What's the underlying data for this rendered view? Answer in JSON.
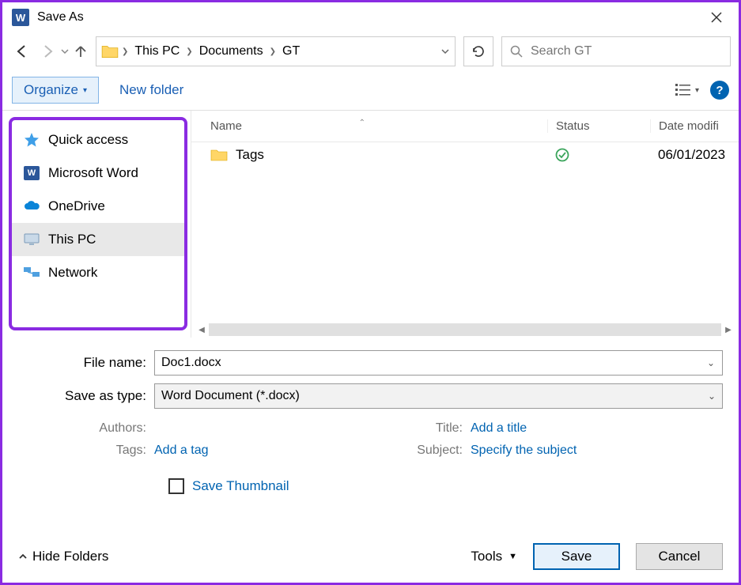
{
  "window": {
    "title": "Save As"
  },
  "breadcrumb": {
    "items": [
      "This PC",
      "Documents",
      "GT"
    ]
  },
  "search": {
    "placeholder": "Search GT"
  },
  "toolbar": {
    "organize": "Organize",
    "new_folder": "New folder"
  },
  "sidebar": {
    "items": [
      {
        "label": "Quick access",
        "icon": "star-icon"
      },
      {
        "label": "Microsoft Word",
        "icon": "word-icon"
      },
      {
        "label": "OneDrive",
        "icon": "cloud-icon"
      },
      {
        "label": "This PC",
        "icon": "pc-icon",
        "selected": true
      },
      {
        "label": "Network",
        "icon": "network-icon"
      }
    ]
  },
  "columns": {
    "name": "Name",
    "status": "Status",
    "date": "Date modifi"
  },
  "files": [
    {
      "name": "Tags",
      "type": "folder",
      "status": "synced",
      "date": "06/01/2023"
    }
  ],
  "form": {
    "file_name_label": "File name:",
    "file_name_value": "Doc1.docx",
    "save_type_label": "Save as type:",
    "save_type_value": "Word Document (*.docx)",
    "authors_label": "Authors:",
    "authors_value": "",
    "tags_label": "Tags:",
    "tags_value": "Add a tag",
    "title_label": "Title:",
    "title_value": "Add a title",
    "subject_label": "Subject:",
    "subject_value": "Specify the subject",
    "save_thumbnail": "Save Thumbnail"
  },
  "footer": {
    "hide_folders": "Hide Folders",
    "tools": "Tools",
    "save": "Save",
    "cancel": "Cancel"
  }
}
